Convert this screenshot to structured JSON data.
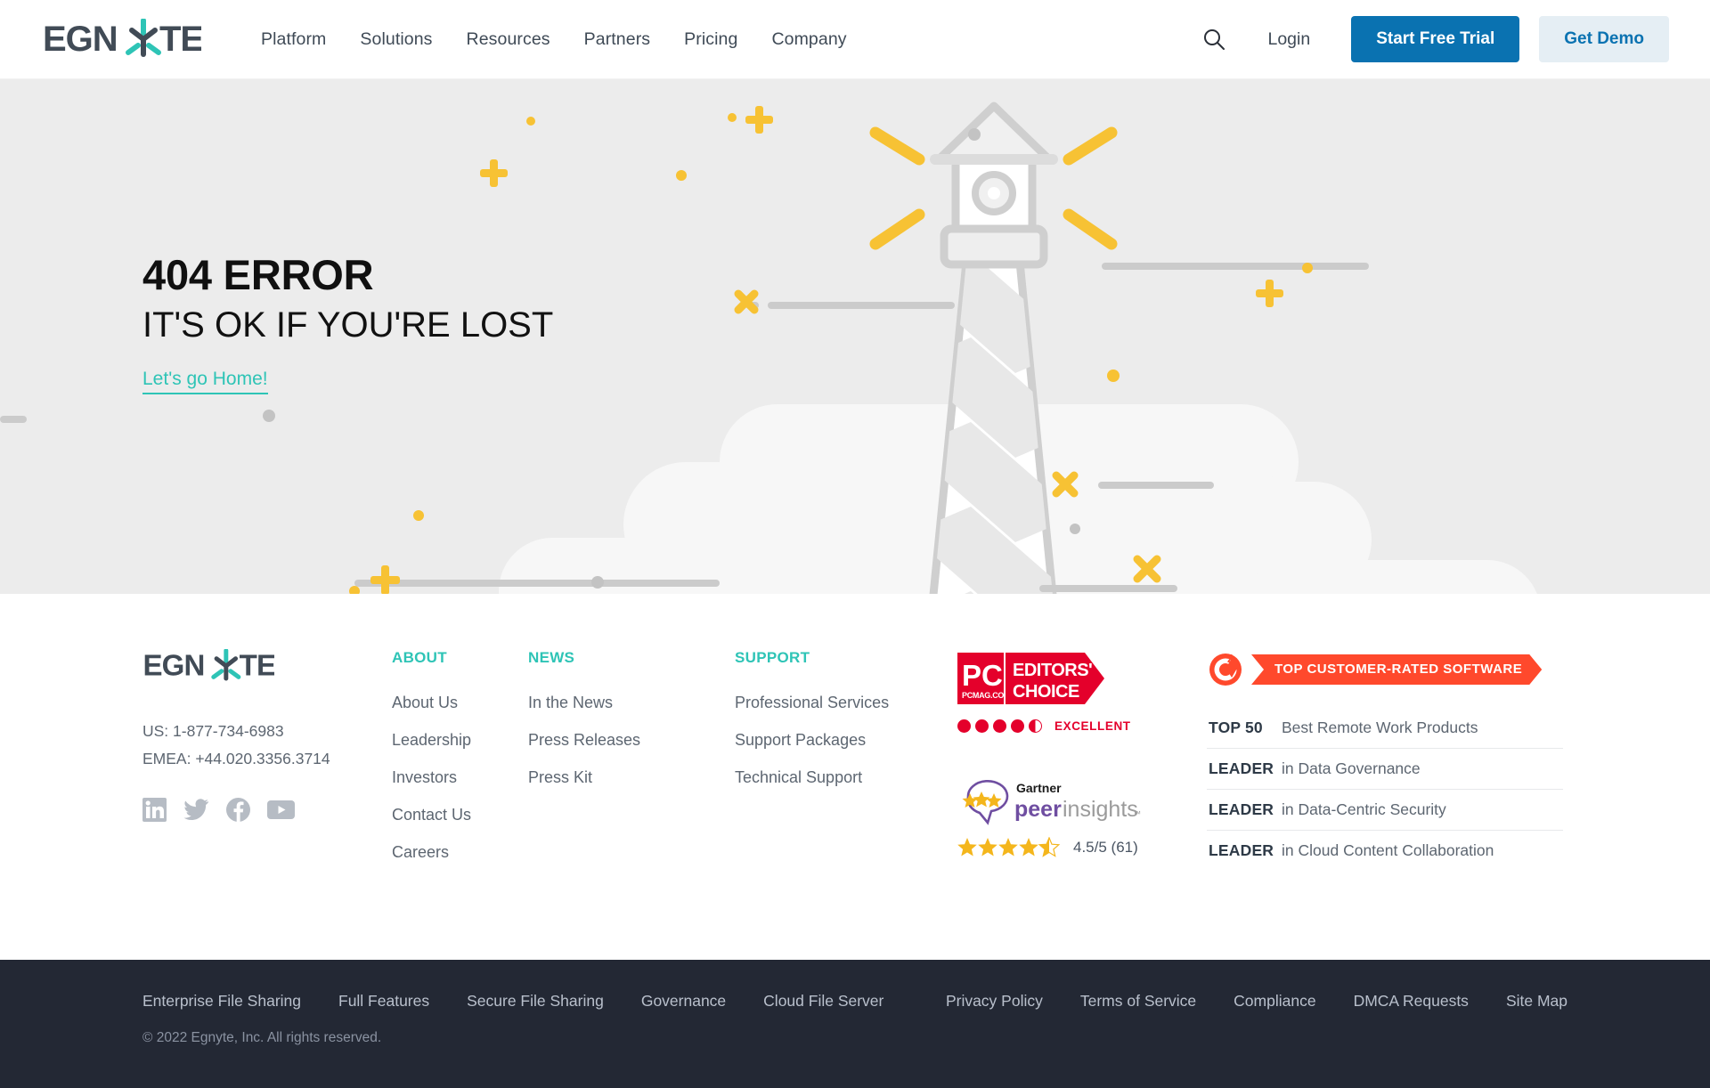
{
  "brand": {
    "name": "EGNYTE",
    "accent_teal": "#2ec4b6",
    "accent_blue": "#0A72B1",
    "dark": "#3f4a56"
  },
  "header": {
    "logo_alt": "EGNYTE",
    "nav": [
      {
        "label": "Platform"
      },
      {
        "label": "Solutions"
      },
      {
        "label": "Resources"
      },
      {
        "label": "Partners"
      },
      {
        "label": "Pricing"
      },
      {
        "label": "Company"
      }
    ],
    "search_icon": "search-icon",
    "login_label": "Login",
    "trial_label": "Start Free Trial",
    "demo_label": "Get Demo"
  },
  "hero": {
    "title": "404 ERROR",
    "subtitle": "IT'S OK IF YOU'RE LOST",
    "link_label": "Let's go Home!",
    "illustration": "lighthouse-illustration",
    "bg_color": "#ececec"
  },
  "footer": {
    "logo_alt": "EGNYTE",
    "phone_us": "US: 1-877-734-6983",
    "phone_emea": "EMEA: +44.020.3356.3714",
    "socials": [
      {
        "name": "linkedin-icon"
      },
      {
        "name": "twitter-icon"
      },
      {
        "name": "facebook-icon"
      },
      {
        "name": "youtube-icon"
      }
    ],
    "columns": [
      {
        "heading": "ABOUT",
        "links": [
          "About Us",
          "Leadership",
          "Investors",
          "Contact Us",
          "Careers"
        ]
      },
      {
        "heading": "NEWS",
        "links": [
          "In the News",
          "Press Releases",
          "Press Kit"
        ]
      },
      {
        "heading": "SUPPORT",
        "links": [
          "Professional Services",
          "Support Packages",
          "Technical Support"
        ]
      }
    ],
    "badges": {
      "pc": {
        "mark": "PC",
        "mark_sub": "PCMAG.COM",
        "line1": "EDITORS'",
        "line2": "CHOICE",
        "rating_label": "EXCELLENT",
        "filled_dots": 4,
        "half_dots": 1,
        "color": "#e4002b"
      },
      "gartner": {
        "brand_top": "Gartner",
        "brand_bottom_bold": "peer",
        "brand_bottom_light": "insights",
        "trademark": "™",
        "score": "4.5/5 (61)",
        "stars": 4.5,
        "color": "#6f4ea1"
      },
      "g2": {
        "mark": "G2",
        "ribbon": "TOP CUSTOMER-RATED SOFTWARE",
        "ribbon_color": "#ff492c",
        "rows": [
          {
            "rank": "TOP 50",
            "desc": "Best Remote Work Products"
          },
          {
            "rank": "LEADER",
            "desc": "in Data Governance"
          },
          {
            "rank": "LEADER",
            "desc": "in Data-Centric Security"
          },
          {
            "rank": "LEADER",
            "desc": "in Cloud Content Collaboration"
          }
        ]
      }
    }
  },
  "footer_bottom": {
    "bg_color": "#232834",
    "left_links": [
      "Enterprise File Sharing",
      "Full Features",
      "Secure File Sharing",
      "Governance",
      "Cloud File Server"
    ],
    "right_links": [
      "Privacy Policy",
      "Terms of Service",
      "Compliance",
      "DMCA Requests",
      "Site Map"
    ],
    "copyright": "© 2022 Egnyte, Inc. All rights reserved."
  }
}
